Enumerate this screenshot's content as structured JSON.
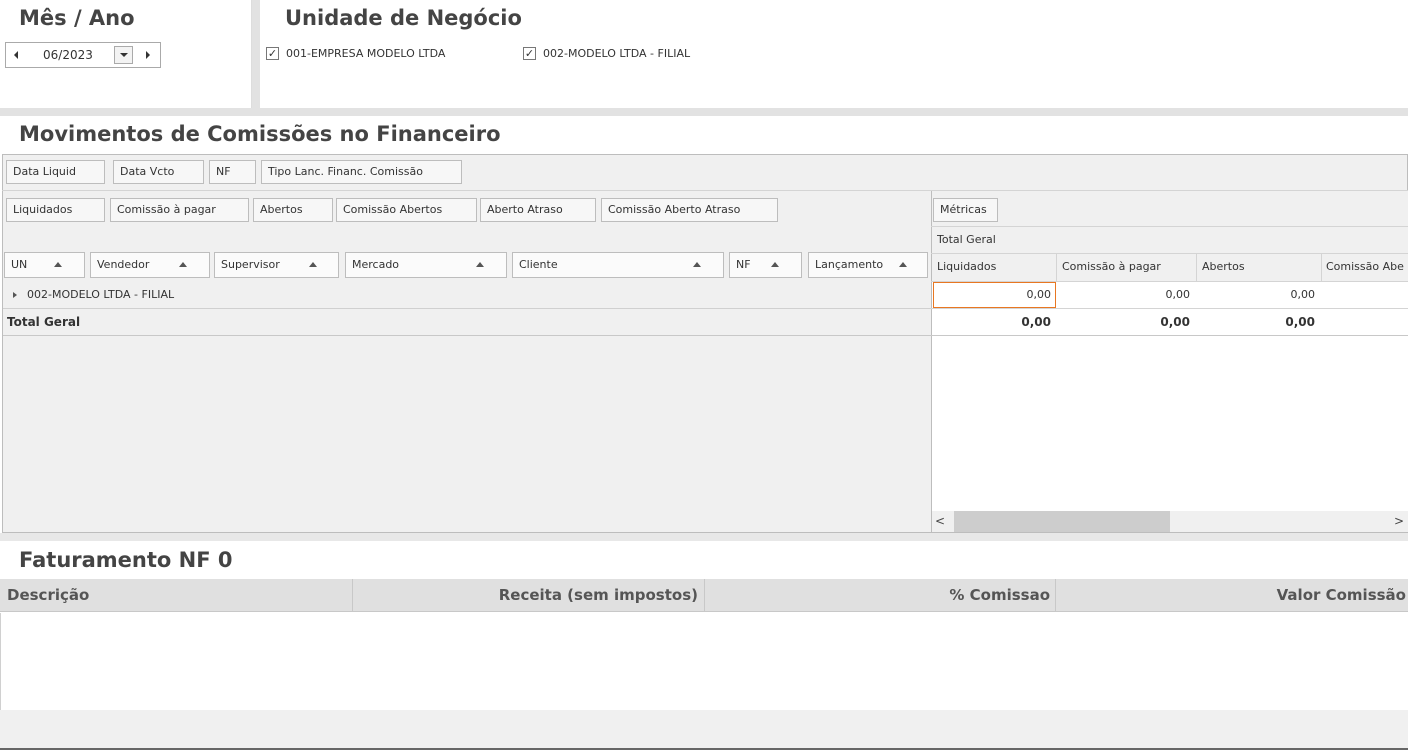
{
  "period": {
    "title": "Mês / Ano",
    "value": "06/2023"
  },
  "business_unit": {
    "title": "Unidade de Negócio",
    "options": [
      {
        "label": "001-EMPRESA MODELO LTDA",
        "checked": true
      },
      {
        "label": "002-MODELO LTDA - FILIAL",
        "checked": true
      }
    ]
  },
  "commissions": {
    "title": "Movimentos de Comissões no Financeiro",
    "filter_fields": [
      "Data Liquid",
      "Data Vcto",
      "NF",
      "Tipo Lanc. Financ. Comissão"
    ],
    "data_fields": [
      "Liquidados",
      "Comissão à pagar",
      "Abertos",
      "Comissão Abertos",
      "Aberto Atraso",
      "Comissão Aberto Atraso"
    ],
    "row_fields": [
      "UN",
      "Vendedor",
      "Supervisor",
      "Mercado",
      "Cliente",
      "NF",
      "Lançamento"
    ],
    "metrics_label": "Métricas",
    "grand_total_header": "Total Geral",
    "value_columns": [
      "Liquidados",
      "Comissão à pagar",
      "Abertos",
      "Comissão Abe"
    ],
    "rows": [
      {
        "label": "002-MODELO LTDA - FILIAL",
        "values": [
          "0,00",
          "0,00",
          "0,00"
        ]
      }
    ],
    "total_row": {
      "label": "Total Geral",
      "values": [
        "0,00",
        "0,00",
        "0,00"
      ]
    },
    "scroll_left": "<",
    "scroll_right": ">"
  },
  "billing": {
    "title": "Faturamento  NF 0",
    "columns": [
      "Descrição",
      "Receita (sem impostos)",
      "% Comissao",
      "Valor Comissão"
    ]
  },
  "colors": {
    "accent_border": "#e87722",
    "panel_gray": "#e0e0e0"
  }
}
